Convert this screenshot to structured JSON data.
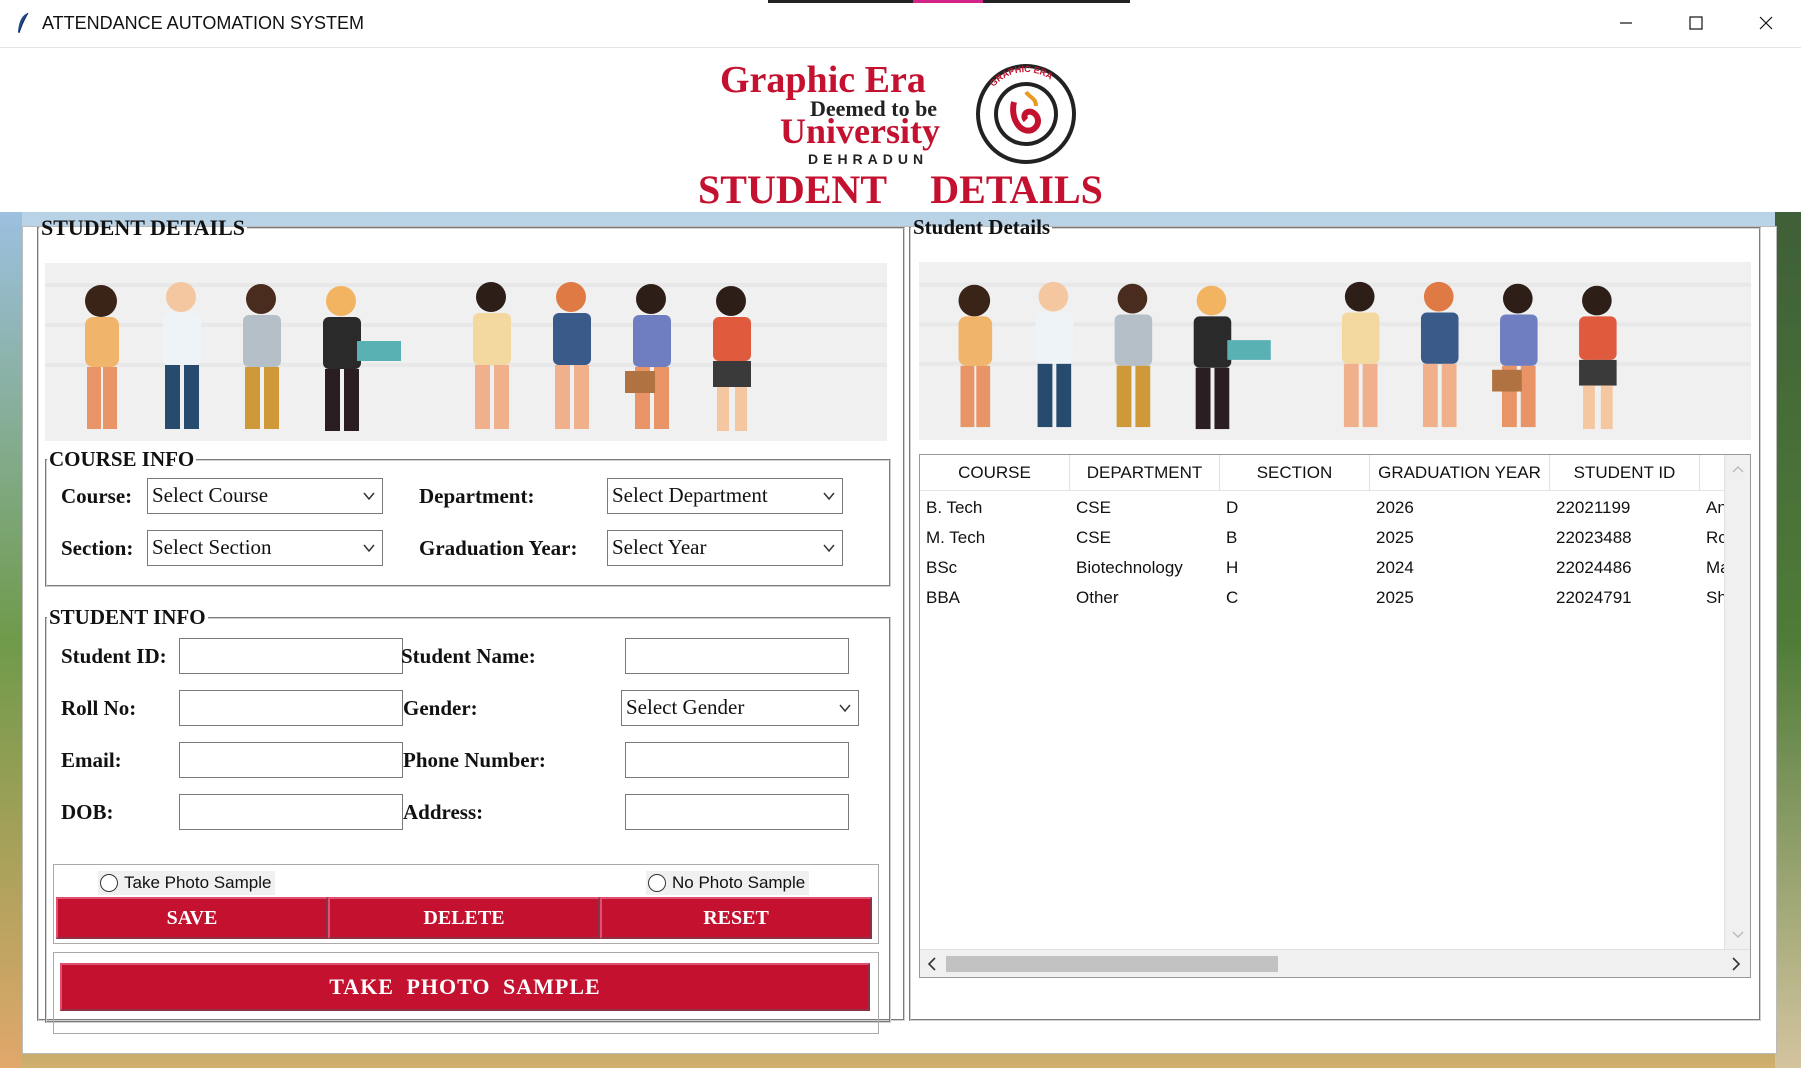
{
  "window": {
    "title": "ATTENDANCE AUTOMATION SYSTEM"
  },
  "logo": {
    "line1": "Graphic Era",
    "line2": "Deemed to be",
    "line3": "University",
    "line4": "DEHRADUN",
    "seal_text": "GRAPHIC ERA · DEEMED TO BE UNIVERSITY"
  },
  "page_title": "STUDENT DETAILS",
  "left_panel": {
    "legend": "STUDENT DETAILS",
    "course_info": {
      "legend": "COURSE INFO",
      "course_label": "Course:",
      "course_value": "Select Course",
      "department_label": "Department:",
      "department_value": "Select Department",
      "section_label": "Section:",
      "section_value": "Select Section",
      "year_label": "Graduation Year:",
      "year_value": "Select Year"
    },
    "student_info": {
      "legend": "STUDENT INFO",
      "student_id_label": "Student ID:",
      "student_name_label": "Student Name:",
      "roll_label": "Roll No:",
      "gender_label": "Gender:",
      "gender_value": "Select Gender",
      "email_label": "Email:",
      "phone_label": "Phone Number:",
      "dob_label": "DOB:",
      "address_label": "Address:",
      "radio_take": "Take Photo Sample",
      "radio_no": "No Photo Sample",
      "save": "SAVE",
      "delete": "DELETE",
      "reset": "RESET",
      "take_photo": "TAKE PHOTO SAMPLE"
    }
  },
  "right_panel": {
    "legend": "Student Details",
    "columns": [
      "COURSE",
      "DEPARTMENT",
      "SECTION",
      "GRADUATION YEAR",
      "STUDENT ID"
    ],
    "rows": [
      [
        "B. Tech",
        "CSE",
        "D",
        "2026",
        "22021199",
        "An"
      ],
      [
        "M. Tech",
        "CSE",
        "B",
        "2025",
        "22023488",
        "Ro"
      ],
      [
        "BSc",
        "Biotechnology",
        "H",
        "2024",
        "22024486",
        "Ma"
      ],
      [
        "BBA",
        "Other",
        "C",
        "2025",
        "22024791",
        "Sh"
      ]
    ]
  },
  "colors": {
    "brand_red": "#c3112f"
  }
}
